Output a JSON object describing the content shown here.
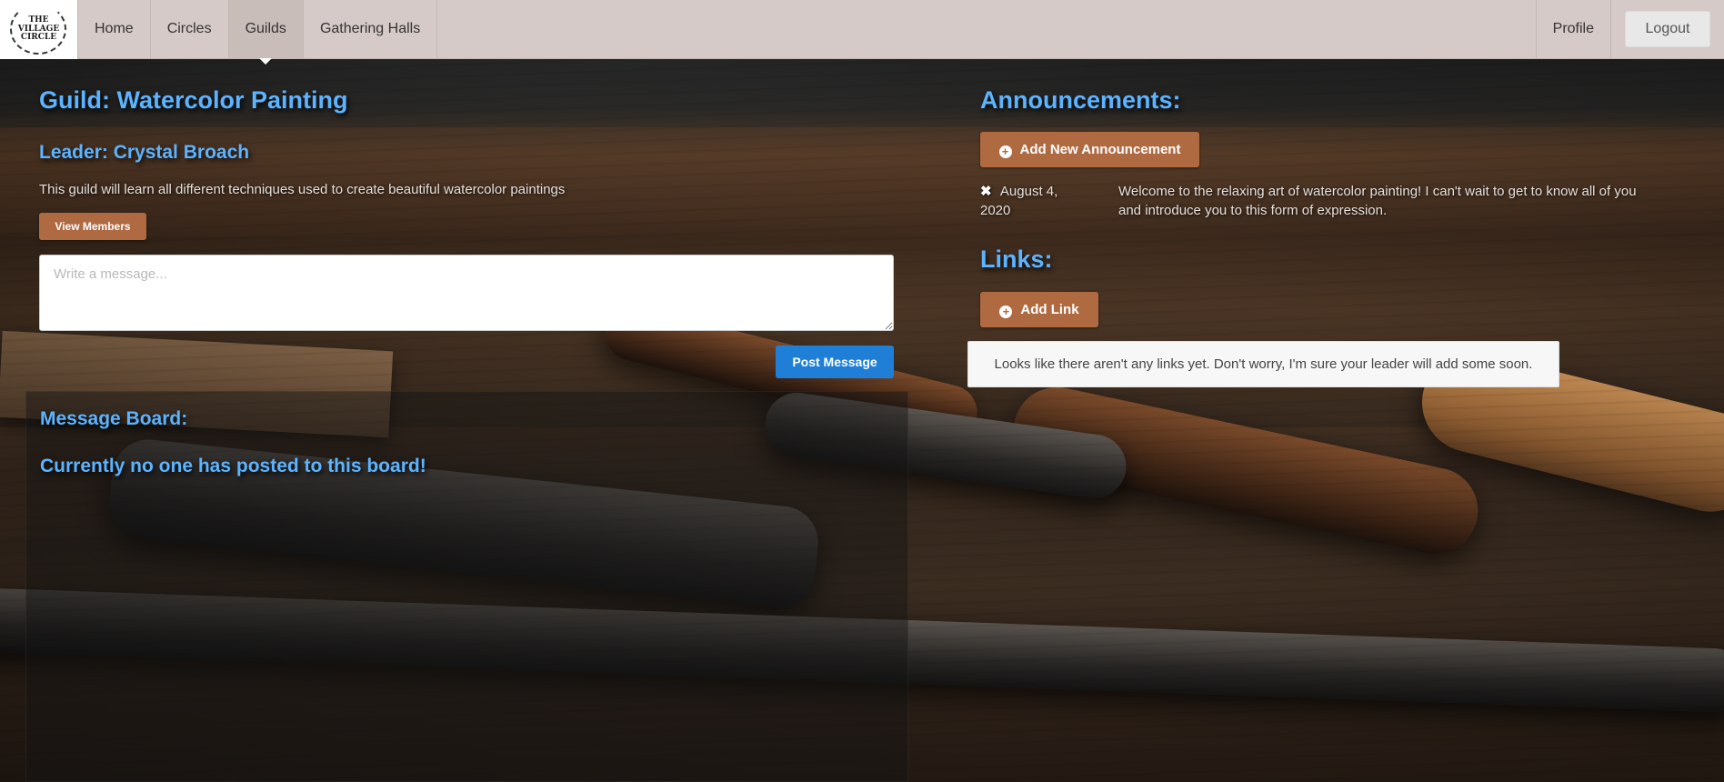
{
  "nav": {
    "logo_text": "THE VILLAGE CIRCLE",
    "items": [
      {
        "label": "Home"
      },
      {
        "label": "Circles"
      },
      {
        "label": "Guilds"
      },
      {
        "label": "Gathering Halls"
      }
    ],
    "active": "Guilds",
    "profile_label": "Profile",
    "logout_label": "Logout"
  },
  "guild": {
    "title": "Guild: Watercolor Painting",
    "leader": "Leader: Crystal Broach",
    "description": "This guild will learn all different techniques used to create beautiful watercolor paintings",
    "view_members_label": "View Members"
  },
  "composer": {
    "placeholder": "Write a message...",
    "post_label": "Post Message"
  },
  "board": {
    "title": "Message Board:",
    "empty_text": "Currently no one has posted to this board!"
  },
  "announcements": {
    "title": "Announcements:",
    "add_label": "Add New Announcement",
    "items": [
      {
        "date": "August 4, 2020",
        "text": "Welcome to the relaxing art of watercolor painting! I can't wait to get to know all of you and introduce you to this form of expression."
      }
    ]
  },
  "links": {
    "title": "Links:",
    "add_label": "Add Link",
    "empty_text": "Looks like there aren't any links yet. Don't worry, I'm sure your leader will add some soon."
  },
  "colors": {
    "heading_blue": "#5cb3ff",
    "brown_button": "#b06a42",
    "post_button": "#1f7fd6",
    "navbar": "#d5cac7"
  },
  "icons": {
    "plus": "plus-circle-icon",
    "delete": "close-icon"
  }
}
